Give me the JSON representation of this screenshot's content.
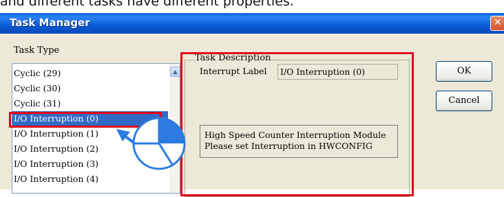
{
  "caption": "and different tasks have different properties.",
  "window": {
    "title": "Task Manager",
    "close_glyph": "✕"
  },
  "task_type": {
    "label": "Task Type",
    "items": [
      "Cyclic (29)",
      "Cyclic (30)",
      "Cyclic (31)",
      "I/O Interruption (0)",
      "I/O Interruption (1)",
      "I/O Interruption (2)",
      "I/O Interruption (3)",
      "I/O Interruption (4)"
    ],
    "selected_index": 3
  },
  "task_description": {
    "legend": "Task Description",
    "interrupt_label_caption": "Interrupt Label",
    "interrupt_label_value": "I/O Interruption (0)",
    "description_line1": "High Speed Counter Interruption Module",
    "description_line2": "Please set Interruption in HWCONFIG"
  },
  "buttons": {
    "ok": "OK",
    "cancel": "Cancel"
  },
  "icons": {
    "scroll_up": "scroll-up-arrow-icon",
    "pointer": "blue-arrow-pointer-icon",
    "click_indicator": "mouse-click-indicator-icon"
  },
  "colors": {
    "title_bar": "#0b5bd6",
    "selection": "#316ac5",
    "highlight": "#e0001a",
    "annotation": "#2b7be0"
  }
}
